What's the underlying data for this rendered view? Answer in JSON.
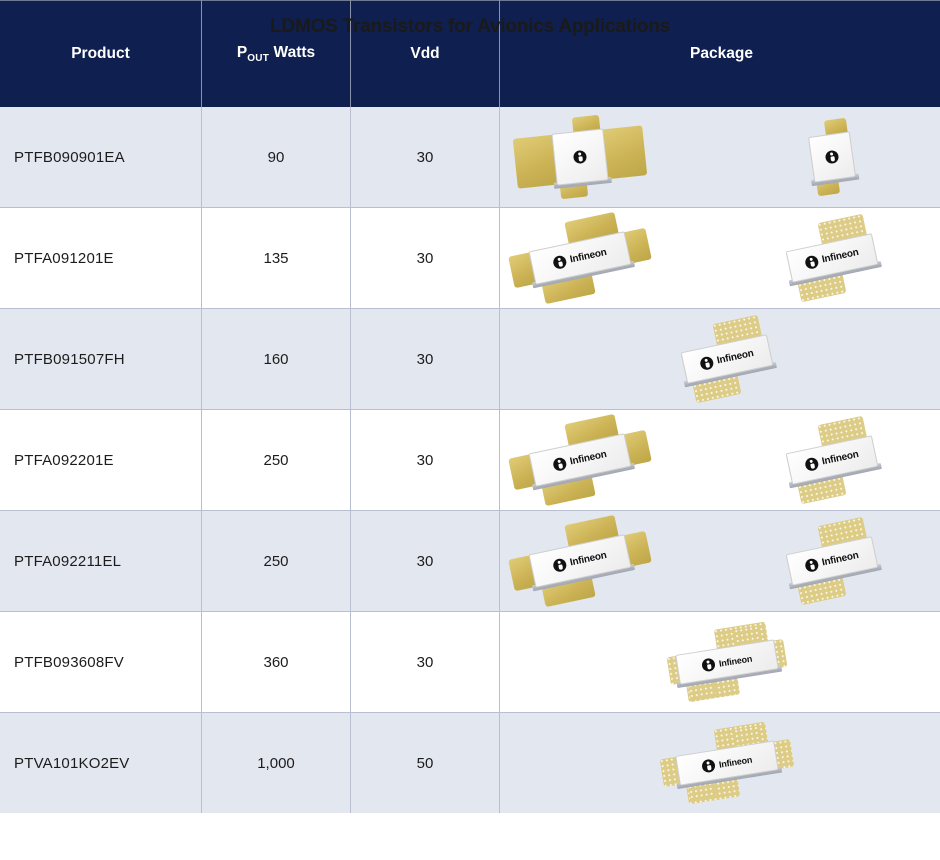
{
  "title": "LDMOS Transistors for Avionics Applications",
  "table": {
    "columns": [
      {
        "id": "product",
        "label": "Product"
      },
      {
        "id": "pout",
        "label_main": "P",
        "label_sub": "OUT",
        "label_tail": "Watts"
      },
      {
        "id": "vdd",
        "label": "Vdd"
      },
      {
        "id": "package",
        "label": "Package"
      }
    ],
    "rows": [
      {
        "product": "PTFB090901EA",
        "pout": "90",
        "vdd": "30",
        "packages": [
          {
            "style": "flanged-square",
            "brand_text": "",
            "position": "left"
          },
          {
            "style": "flat-square",
            "brand_text": "",
            "position": "right"
          }
        ]
      },
      {
        "product": "PTFA091201E",
        "pout": "135",
        "vdd": "30",
        "packages": [
          {
            "style": "flanged-wide",
            "brand_text": "Infineon",
            "position": "left"
          },
          {
            "style": "flat-wide",
            "brand_text": "Infineon",
            "position": "right"
          }
        ]
      },
      {
        "product": "PTFB091507FH",
        "pout": "160",
        "vdd": "30",
        "packages": [
          {
            "style": "flat-wide",
            "brand_text": "Infineon",
            "position": "center"
          }
        ]
      },
      {
        "product": "PTFA092201E",
        "pout": "250",
        "vdd": "30",
        "packages": [
          {
            "style": "flanged-wide",
            "brand_text": "Infineon",
            "position": "left"
          },
          {
            "style": "flat-wide",
            "brand_text": "Infineon",
            "position": "right"
          }
        ]
      },
      {
        "product": "PTFA092211EL",
        "pout": "250",
        "vdd": "30",
        "packages": [
          {
            "style": "flanged-wide",
            "brand_text": "Infineon",
            "position": "left"
          },
          {
            "style": "flat-wide",
            "brand_text": "Infineon",
            "position": "right"
          }
        ]
      },
      {
        "product": "PTFB093608FV",
        "pout": "360",
        "vdd": "30",
        "packages": [
          {
            "style": "multi-lead-flat",
            "brand_text": "Infineon",
            "position": "center"
          }
        ]
      },
      {
        "product": "PTVA101KO2EV",
        "pout": "1,000",
        "vdd": "50",
        "packages": [
          {
            "style": "multi-lead-flanged",
            "brand_text": "Infineon",
            "position": "center"
          }
        ]
      }
    ]
  },
  "colors": {
    "header_bg": "#0F1F4F",
    "header_text": "#FFFFFF",
    "row_alt_bg": "#E3E7F0",
    "row_bg": "#FFFFFF",
    "grid_line": "#B9BFD0",
    "title_text": "#1A1A1A",
    "lead_gold": "#CDB457",
    "lead_gold_pattern": "#DDCC86",
    "package_body": "#FFFFFF"
  }
}
